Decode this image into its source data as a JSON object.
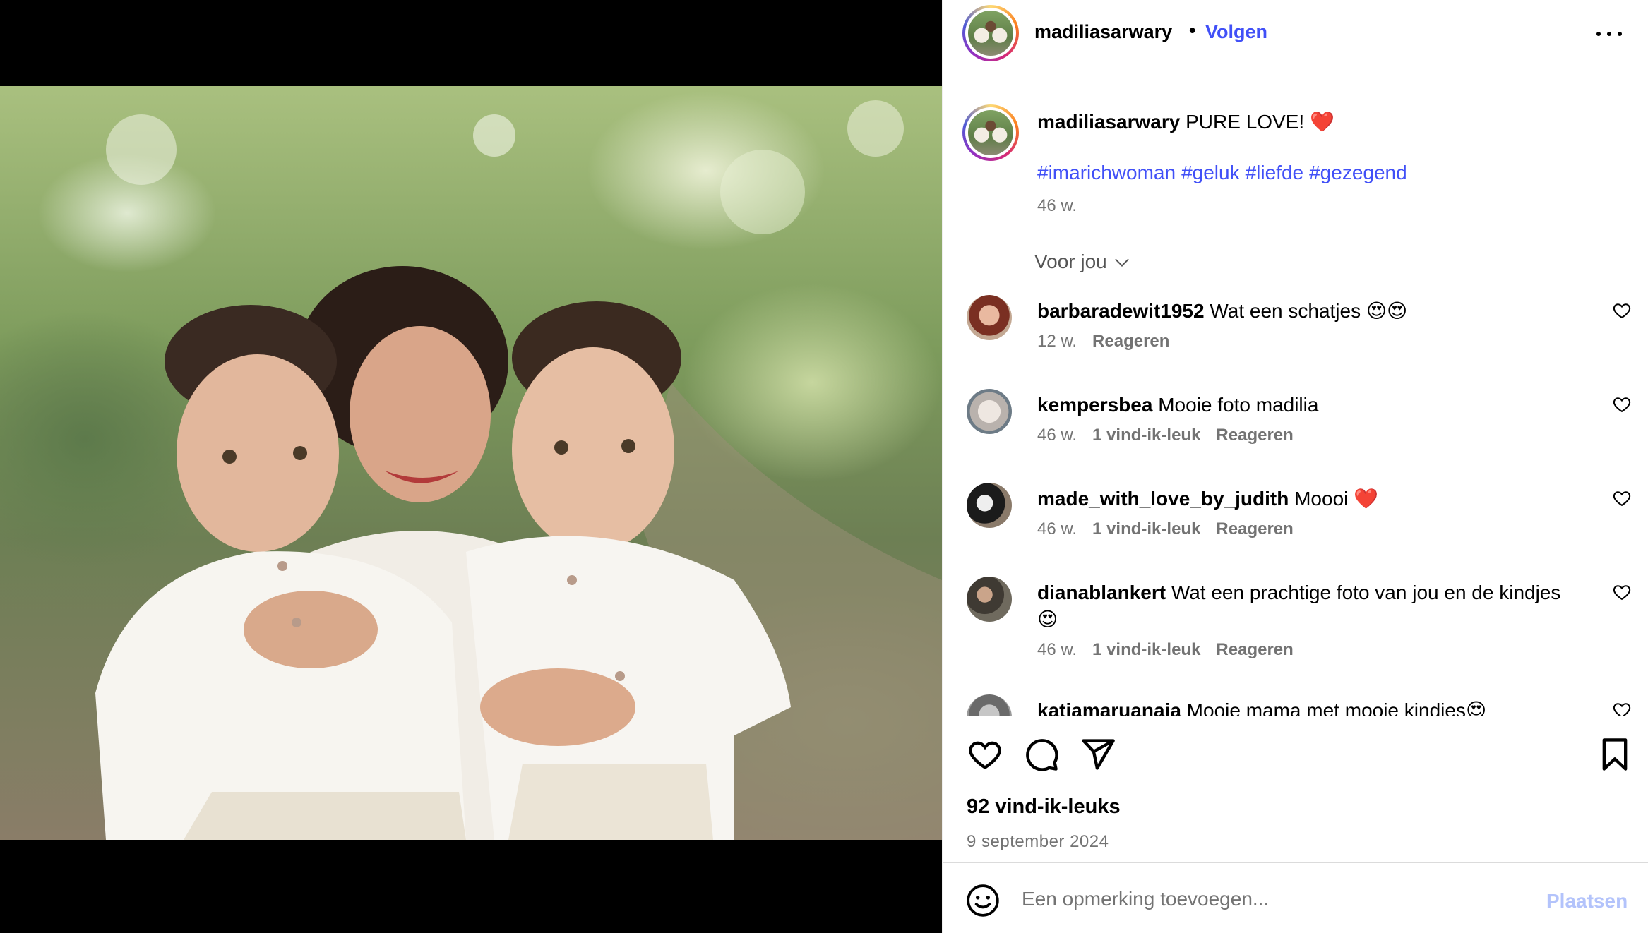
{
  "post": {
    "username": "madiliasarwary",
    "separator": "•",
    "follow_label": "Volgen",
    "more_icon": "more-horizontal-icon"
  },
  "caption": {
    "username": "madiliasarwary",
    "text": "PURE LOVE!",
    "emoji": "❤️",
    "hashtags": [
      "#imarichwoman",
      "#geluk",
      "#liefde",
      "#gezegend"
    ],
    "time": "46 w."
  },
  "sort": {
    "label": "Voor jou"
  },
  "comments": [
    {
      "username": "barbaradewit1952",
      "text": "Wat een schatjes 😍😍",
      "time": "12 w.",
      "likes": "",
      "reply": "Reageren"
    },
    {
      "username": "kempersbea",
      "text": "Mooie foto madilia",
      "time": "46 w.",
      "likes": "1 vind-ik-leuk",
      "reply": "Reageren"
    },
    {
      "username": "made_with_love_by_judith",
      "text": "Moooi ❤️",
      "time": "46 w.",
      "likes": "1 vind-ik-leuk",
      "reply": "Reageren"
    },
    {
      "username": "dianablankert",
      "text": "Wat een prachtige foto van jou en de kindjes 😍",
      "time": "46 w.",
      "likes": "1 vind-ik-leuk",
      "reply": "Reageren"
    },
    {
      "username": "katiamaruanaia",
      "text": "Mooie mama met mooie kindies😍",
      "time": "",
      "likes": "",
      "reply": ""
    }
  ],
  "actions": {
    "likes": "92 vind-ik-leuks",
    "date": "9 september 2024"
  },
  "composer": {
    "placeholder": "Een opmerking toevoegen...",
    "post_label": "Plaatsen"
  },
  "colors": {
    "link": "#4150f7",
    "muted": "#737373",
    "divider": "#dbdbdb",
    "post_disabled": "#b3c3fb"
  }
}
